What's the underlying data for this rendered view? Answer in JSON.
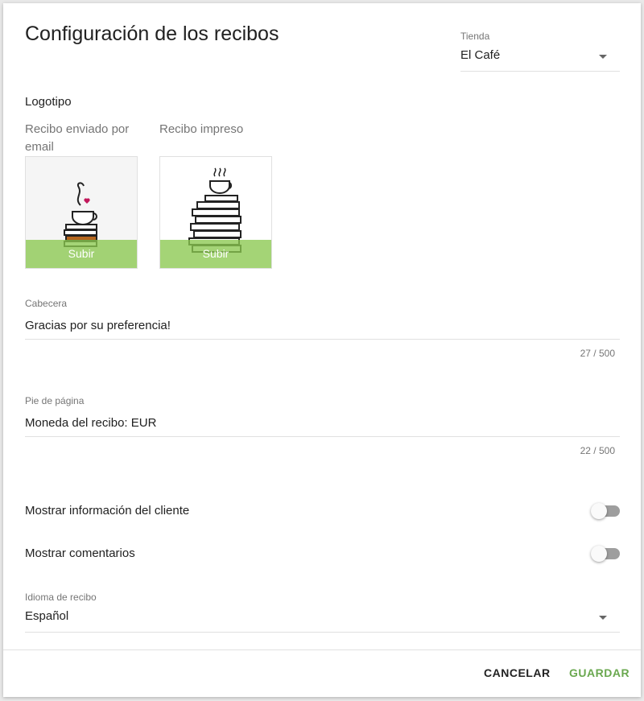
{
  "dialog": {
    "title": "Configuración de los recibos"
  },
  "store": {
    "label": "Tienda",
    "value": "El Café"
  },
  "logo": {
    "title": "Logotipo",
    "email_caption": "Recibo enviado por email",
    "print_caption": "Recibo impreso",
    "upload_label": "Subir",
    "accent": "#8bc850"
  },
  "header_field": {
    "label": "Cabecera",
    "value": "Gracias por su preferencia!",
    "counter": "27 / 500"
  },
  "footer_field": {
    "label": "Pie de página",
    "value": "Moneda del recibo: EUR",
    "counter": "22 / 500"
  },
  "toggles": {
    "show_customer": {
      "label": "Mostrar información del cliente",
      "on": false
    },
    "show_comments": {
      "label": "Mostrar comentarios",
      "on": false
    }
  },
  "language": {
    "label": "Idioma de recibo",
    "value": "Español"
  },
  "actions": {
    "cancel": "CANCELAR",
    "save": "GUARDAR",
    "save_color": "#6aa84f"
  }
}
